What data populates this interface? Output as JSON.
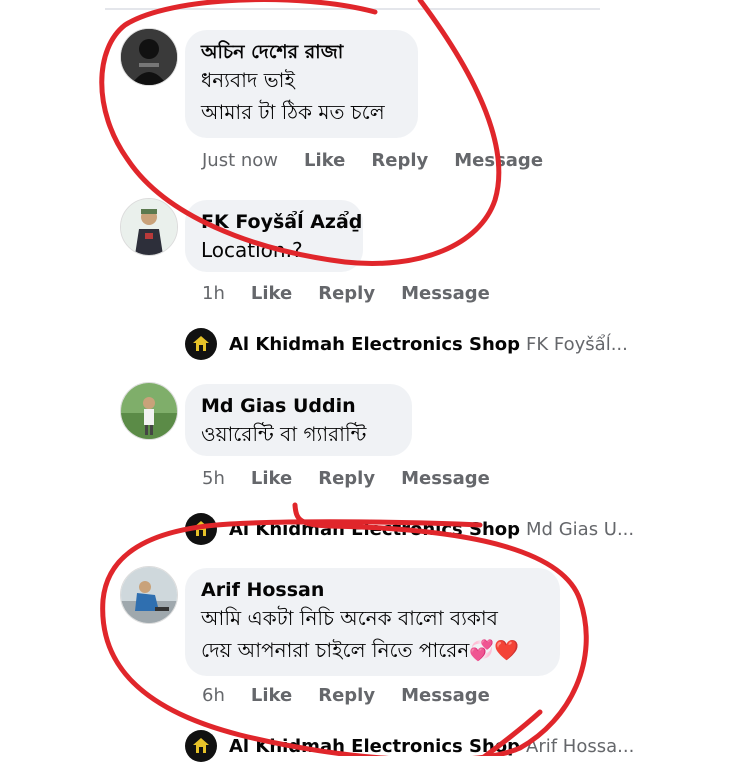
{
  "comments": [
    {
      "author": "অচিন দেশের রাজা",
      "lines": [
        "ধন্যবাদ ভাই",
        "আমার টা ঠিক মত চলে"
      ],
      "time": "Just now",
      "like": "Like",
      "reply": "Reply",
      "message": "Message"
    },
    {
      "author": "FK Foyšẩĺ Azẩḏ",
      "lines": [
        "Location.?"
      ],
      "time": "1h",
      "like": "Like",
      "reply": "Reply",
      "message": "Message",
      "shop_reply": {
        "shop": "Al Khidmah Electronics Shop",
        "preview": "FK Foyšẩĺ..."
      }
    },
    {
      "author": "Md Gias Uddin",
      "lines": [
        "ওয়ারেন্টি বা গ্যারান্টি"
      ],
      "time": "5h",
      "like": "Like",
      "reply": "Reply",
      "message": "Message",
      "shop_reply": {
        "shop": "Al Khidmah Electronics Shop",
        "preview": "Md Gias U..."
      }
    },
    {
      "author": "Arif Hossan",
      "lines": [
        "আমি একটা নিচি  অনেক বালো ব্যকাব",
        "দেয় আপনারা চাইলে নিতে পারেন💞❤️"
      ],
      "time": "6h",
      "like": "Like",
      "reply": "Reply",
      "message": "Message",
      "shop_reply": {
        "shop": "Al Khidmah Electronics Shop",
        "preview": "Arif Hossa..."
      }
    }
  ],
  "colors": {
    "bubble": "#f0f2f5",
    "meta": "#65676b",
    "annotation": "#e0262b"
  },
  "icons": [
    "avatar",
    "shop-logo-icon"
  ]
}
